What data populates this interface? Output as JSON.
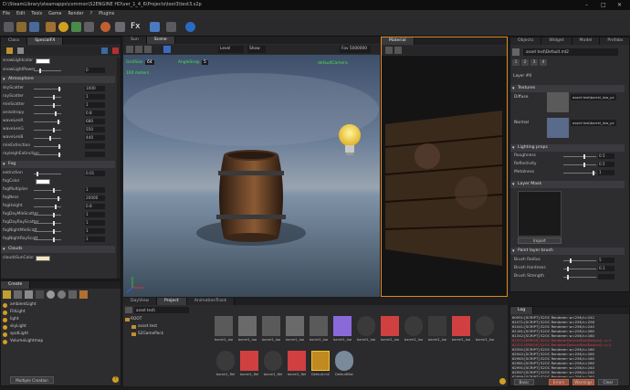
{
  "window": {
    "title": "D:\\SteamLibrary\\steamapps\\common\\S2ENGINE HD\\ver_1_4_6\\Projects\\test3\\test3.s2p"
  },
  "menu": [
    "File",
    "Edit",
    "Tools",
    "Game",
    "Render",
    "?",
    "Plugins"
  ],
  "left": {
    "tabs": [
      "Class",
      "SpecialFX"
    ],
    "rows": [
      {
        "label": "snowLightcolor",
        "kind": "color",
        "color": "#ffffff"
      },
      {
        "label": "snowLightPower",
        "kind": "slider",
        "value": "0",
        "pos": 0.2
      }
    ],
    "sections": [
      {
        "title": "Atmosphere",
        "rows": [
          {
            "label": "skyScatter",
            "value": "1000",
            "pos": 0.9
          },
          {
            "label": "rayScatter",
            "value": "1",
            "pos": 0.7
          },
          {
            "label": "mieScatter",
            "value": "1",
            "pos": 0.7
          },
          {
            "label": "anisotropy",
            "value": "0.8",
            "pos": 0.75
          },
          {
            "label": "waveLenR",
            "value": "680",
            "pos": 0.85
          },
          {
            "label": "waveLenG",
            "value": "550",
            "pos": 0.7
          },
          {
            "label": "waveLenB",
            "value": "440",
            "pos": 0.55
          },
          {
            "label": "mieExtinction",
            "value": "",
            "pos": 0.9
          },
          {
            "label": "rayleighExtinction",
            "value": "",
            "pos": 0.9
          }
        ]
      },
      {
        "title": "Fog",
        "rows": [
          {
            "label": "extinction",
            "value": "0.01",
            "pos": 0.1
          },
          {
            "label": "fogColor",
            "kind": "color",
            "color": "#ffffff"
          },
          {
            "label": "fogMultiplier",
            "value": "1",
            "pos": 0.7
          },
          {
            "label": "fogNear",
            "value": "20000",
            "pos": 0.85
          },
          {
            "label": "fogHeight",
            "value": "0.8",
            "pos": 0.75
          },
          {
            "label": "fogDayMieScatter",
            "value": "1",
            "pos": 0.7
          },
          {
            "label": "fogDayRayScatter",
            "value": "1",
            "pos": 0.7
          },
          {
            "label": "fogNightMieScatt",
            "value": "1",
            "pos": 0.7
          },
          {
            "label": "fogNightRayScatt",
            "value": "1",
            "pos": 0.7
          }
        ]
      },
      {
        "title": "Clouds",
        "rows": [
          {
            "label": "cloudsSunColor",
            "kind": "color",
            "color": "#f5e4c0"
          }
        ]
      }
    ]
  },
  "create": {
    "title": "Create",
    "items": [
      "ambientLight",
      "FillLight",
      "light",
      "skyLight",
      "spotLight",
      "VolumeLightmap"
    ],
    "button": "Multiple Creation",
    "help": "?"
  },
  "viewport": {
    "tabs": [
      "Sun",
      "Scene"
    ],
    "toolbar": {
      "level": "Level",
      "show": "Show",
      "fov": "Fov 5000000"
    },
    "gridsize": "GridSize",
    "gridval": "64",
    "anglesnap": "AngleSnap",
    "angleval": "5",
    "meters": "100 meters",
    "camera": "defaultCamera"
  },
  "material": {
    "tab": "Material",
    "file": "asset test\\Default.mt2"
  },
  "right": {
    "tabs": [
      "Objects",
      "Widget",
      "Model",
      "Prefabs",
      "Texture",
      "Materia"
    ],
    "file": "asset test\\Default.mt2",
    "layer": "Layer #0",
    "textures": {
      "title": "Textures",
      "diffuse": "Diffuse",
      "diffuse_file": "asset test\\barrel_low_pc",
      "normal": "Normal",
      "normal_file": "asset test\\barrel_low_pc"
    },
    "lighting": {
      "title": "Lighting props",
      "rows": [
        {
          "label": "Roughness",
          "value": "0.5",
          "pos": 0.6
        },
        {
          "label": "Reflectivity",
          "value": "0.5",
          "pos": 0.6
        },
        {
          "label": "Metalness",
          "value": "1",
          "pos": 0.9
        }
      ]
    },
    "mask": {
      "title": "Layer Mask",
      "import": "Import"
    },
    "paint": {
      "title": "Paint layer brush",
      "rows": [
        {
          "label": "Brush Radius",
          "value": "5",
          "pos": 0.2
        },
        {
          "label": "Brush Hardness",
          "value": "0.1",
          "pos": 0.1
        },
        {
          "label": "Brush Strength",
          "value": "",
          "pos": 0.1
        }
      ]
    }
  },
  "project": {
    "tabs": [
      "DayView",
      "Project",
      "AnimationTrack"
    ],
    "search": "asset test\\",
    "tree": [
      "ROOT",
      "asset test",
      "S2GamePack"
    ],
    "assets_row1": [
      "barrel1_low_pc",
      "barrel1_low_pc",
      "barrel1_low_pc",
      "barrel1_low_pc",
      "barrel1_low_pc",
      "barrel1_low_pc",
      "barrel1_low_pc",
      "barrel1_low_pc",
      "barrel1_low_pc",
      "barrel1_low_pc",
      "barrel1_low_pc",
      "barrel1_low_pc"
    ],
    "assets_row2": [
      "barrel1_Retopo",
      "barrel1_Retopo",
      "barrel1_Retopo",
      "barrel1_Retopo",
      "Default.mt2",
      "DefaultMaterial"
    ]
  },
  "log": {
    "tab": "Log",
    "lines": [
      {
        "t": "60951:[SCRIPT] S2OC Renderer: w=256,h=242",
        "c": "#d0d0d0"
      },
      {
        "t": "61071:[SCRIPT] S2OC Renderer: w=256,h=256",
        "c": "#d0d0d0"
      },
      {
        "t": "61041:[SCRIPT] S2OC Renderer: w=256,h=240",
        "c": "#d0d0d0"
      },
      {
        "t": "61161:[SCRIPT] S2OC Renderer: w=256,h=260",
        "c": "#d0d0d0"
      },
      {
        "t": "61342:[SCRIPT] S2OC Renderer: w=256,h=160",
        "c": "#d0d0d0"
      },
      {
        "t": "61971:[ERROR] S2OC RendererDevice:BindDevice(): s=1",
        "c": "#e04040"
      },
      {
        "t": "62221:[ERROR] S2OC RendererDevice:BindDevice(): s=1",
        "c": "#e04040"
      },
      {
        "t": "62592:[SCRIPT] S2OC Renderer: w=256,h=160",
        "c": "#d0d0d0"
      },
      {
        "t": "62942:[SCRIPT] S2OC Renderer: w=256,h=260",
        "c": "#d0d0d0"
      },
      {
        "t": "62963:[SCRIPT] S2OC Renderer: w=256,h=160",
        "c": "#d0d0d0"
      },
      {
        "t": "62981:[SCRIPT] S2OC Renderer: w=256,h=260",
        "c": "#d0d0d0"
      },
      {
        "t": "62991:[SCRIPT] S2OC Renderer: w=256,h=240",
        "c": "#d0d0d0"
      },
      {
        "t": "62997:[SCRIPT] S2OC Renderer: w=256,h=240",
        "c": "#d0d0d0"
      },
      {
        "t": "62999:[SCRIPT] S2OC Renderer: w=256,h=260",
        "c": "#d0d0d0"
      }
    ],
    "basic": "Basic",
    "errors": "Errors",
    "warnings": "Warnings",
    "clear": "Clear"
  }
}
